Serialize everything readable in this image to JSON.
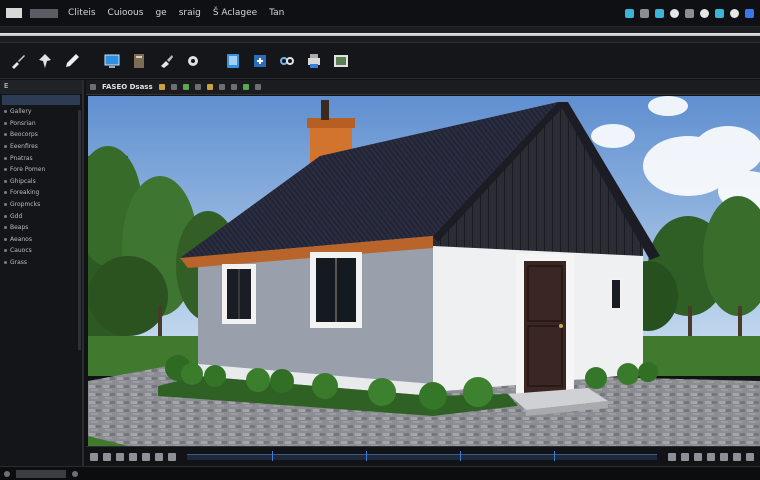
{
  "menubar": {
    "items": [
      "Cliteis",
      "Cuioous",
      "ge",
      "sraig",
      "Š Aclagee",
      "Tan"
    ],
    "right_icons": [
      "panel-icon",
      "window-icon",
      "refresh-icon",
      "help-icon",
      "settings-icon",
      "user-icon",
      "camera-icon",
      "info-icon",
      "close-icon"
    ]
  },
  "toolbar": {
    "tools": [
      "brush-tool",
      "sculpt-tool",
      "pen-tool",
      "monitor-tool",
      "book-tool",
      "paint-tool",
      "gear-tool",
      "tablet-tool",
      "export-tool",
      "link-tool",
      "print-tool",
      "photo-tool"
    ]
  },
  "leftpanel": {
    "title": "E",
    "items": [
      "Gallery",
      "Ponsrian",
      "Beocorps",
      "Eeenfires",
      "Pnatras",
      "Fore Pomen",
      "Ghipcals",
      "Foreaking",
      "Gropmcks",
      "Gdd",
      "Beaps",
      "Aeanos",
      "Cauocs",
      "Grass"
    ]
  },
  "viewport": {
    "title": "FASEO Dsass",
    "colors": {
      "sky_top": "#5f8fd0",
      "sky_bottom": "#c8dcf0",
      "roof": "#24263a",
      "wall_left": "#9aa0ab",
      "wall_right": "#eef0f2",
      "chimney": "#d2742e",
      "gable": "#2b2d35",
      "door": "#3a2622",
      "grass": "#3f7a2e",
      "pavement": "#8b8d92"
    }
  },
  "timeline": {
    "left_icons": [
      "play-icon",
      "prev-icon",
      "next-icon",
      "record-icon",
      "loop-icon",
      "key-icon",
      "layer-icon"
    ],
    "right_icons": [
      "layers-icon",
      "eye-icon",
      "lock-icon",
      "folder-icon",
      "trash-icon",
      "add-icon",
      "zoom-icon"
    ]
  },
  "status": {
    "text": ""
  }
}
